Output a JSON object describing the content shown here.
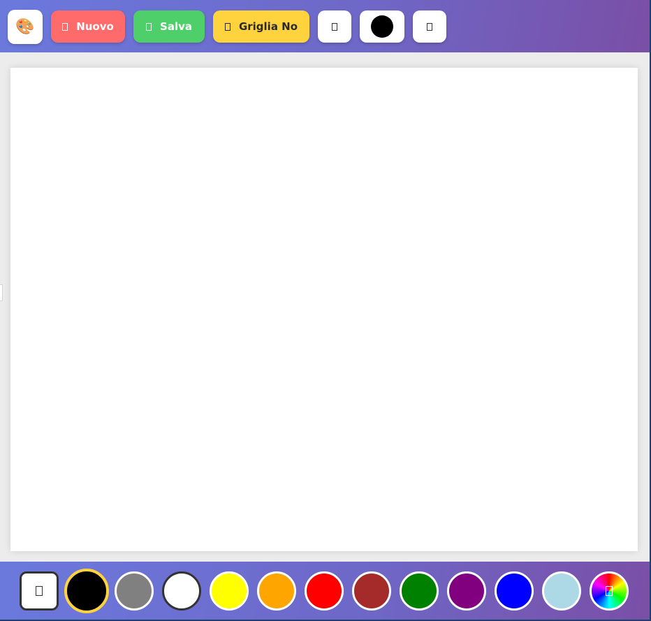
{
  "toolbar": {
    "palette_icon": "palette-icon",
    "new_label": "Nuovo",
    "save_label": "Salva",
    "grid_label": "Griglia No",
    "new_icon": "new-file-icon",
    "save_icon": "save-icon",
    "grid_icon": "grid-icon",
    "tool_left_icon": "tool-icon",
    "brush_size_icon": "brush-size-icon",
    "tool_right_icon": "tool-icon",
    "colors": {
      "new_bg": "#ff6b6b",
      "save_bg": "#4fcf6a",
      "grid_bg": "#ffd33d"
    }
  },
  "canvas": {
    "background": "#ffffff"
  },
  "palette": {
    "eraser_icon": "eraser-icon",
    "selected_color": "#000000",
    "swatches": [
      {
        "name": "black",
        "color": "#000000"
      },
      {
        "name": "gray",
        "color": "#808080"
      },
      {
        "name": "white",
        "color": "#ffffff"
      },
      {
        "name": "yellow",
        "color": "#ffff00"
      },
      {
        "name": "orange",
        "color": "#ffa500"
      },
      {
        "name": "red",
        "color": "#ff0000"
      },
      {
        "name": "brown",
        "color": "#a52a2a"
      },
      {
        "name": "green",
        "color": "#008000"
      },
      {
        "name": "purple",
        "color": "#800080"
      },
      {
        "name": "blue",
        "color": "#0000ff"
      },
      {
        "name": "lightblue",
        "color": "#add8e6"
      }
    ],
    "custom_picker_icon": "color-picker-icon"
  }
}
